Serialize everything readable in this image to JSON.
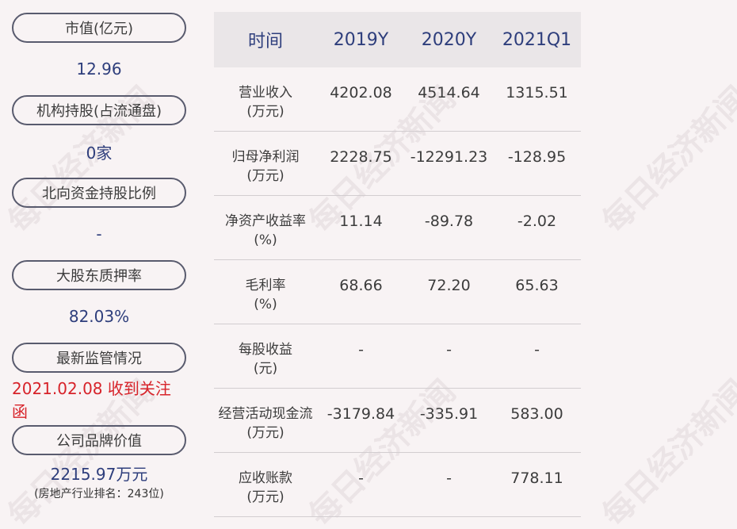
{
  "left": {
    "items": [
      {
        "label": "市值(亿元)",
        "value": "12.96"
      },
      {
        "label": "机构持股(占流通盘)",
        "value": "0家"
      },
      {
        "label": "北向资金持股比例",
        "value": "-"
      },
      {
        "label": "大股东质押率",
        "value": "82.03%"
      },
      {
        "label": "最新监管情况",
        "value": "2021.02.08 收到关注函"
      },
      {
        "label": "公司品牌价值",
        "value": "2215.97万元",
        "sub": "(房地产行业排名：243位)"
      }
    ]
  },
  "table": {
    "headers": [
      "时间",
      "2019Y",
      "2020Y",
      "2021Q1"
    ],
    "rows": [
      {
        "line1": "营业收入",
        "line2": "(万元)",
        "values": [
          "4202.08",
          "4514.64",
          "1315.51"
        ]
      },
      {
        "line1": "归母净利润",
        "line2": "(万元)",
        "values": [
          "2228.75",
          "-12291.23",
          "-128.95"
        ]
      },
      {
        "line1": "净资产收益率",
        "line2": "(%)",
        "values": [
          "11.14",
          "-89.78",
          "-2.02"
        ]
      },
      {
        "line1": "毛利率",
        "line2": "(%)",
        "values": [
          "68.66",
          "72.20",
          "65.63"
        ]
      },
      {
        "line1": "每股收益",
        "line2": "(元)",
        "values": [
          "-",
          "-",
          "-"
        ]
      },
      {
        "line1": "经营活动现金流",
        "line2": "(万元)",
        "values": [
          "-3179.84",
          "-335.91",
          "583.00"
        ]
      },
      {
        "line1": "应收账款",
        "line2": "(万元)",
        "values": [
          "-",
          "-",
          "778.11"
        ]
      }
    ]
  },
  "watermark": "每日经济新闻",
  "colors": {
    "value_blue": "#2e3e7c",
    "alert_red": "#d7232a",
    "header_bg": "#eae6e8"
  }
}
